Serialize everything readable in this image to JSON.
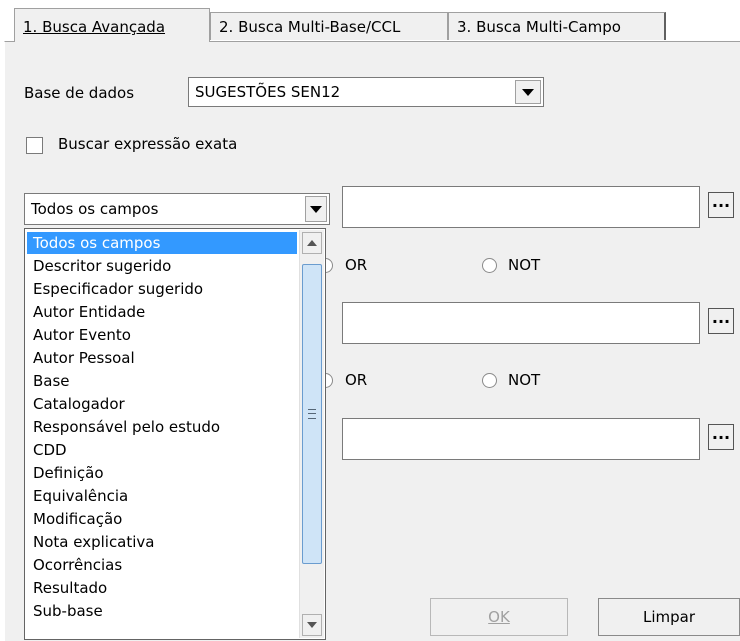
{
  "tabs": [
    {
      "label": "1. Busca Avançada"
    },
    {
      "label": "2. Busca Multi-Base/CCL"
    },
    {
      "label": "3. Busca Multi-Campo"
    }
  ],
  "database": {
    "label": "Base de dados",
    "value": "SUGESTÕES SEN12"
  },
  "exact_phrase": {
    "label": "Buscar expressão exata",
    "checked": false
  },
  "field_select": {
    "value": "Todos os campos"
  },
  "field_options": [
    "Todos os campos",
    "Descritor sugerido",
    "Especificador sugerido",
    "Autor Entidade",
    "Autor Evento",
    "Autor Pessoal",
    "Base",
    "Catalogador",
    "Responsável pelo estudo",
    "CDD",
    "Definição",
    "Equivalência",
    "Modificação",
    "Nota explicativa",
    "Ocorrências",
    "Resultado",
    "Sub-base"
  ],
  "operators": {
    "or": "OR",
    "not": "NOT"
  },
  "ellipsis_label": "...",
  "buttons": {
    "ok": "OK",
    "clear": "Limpar"
  }
}
